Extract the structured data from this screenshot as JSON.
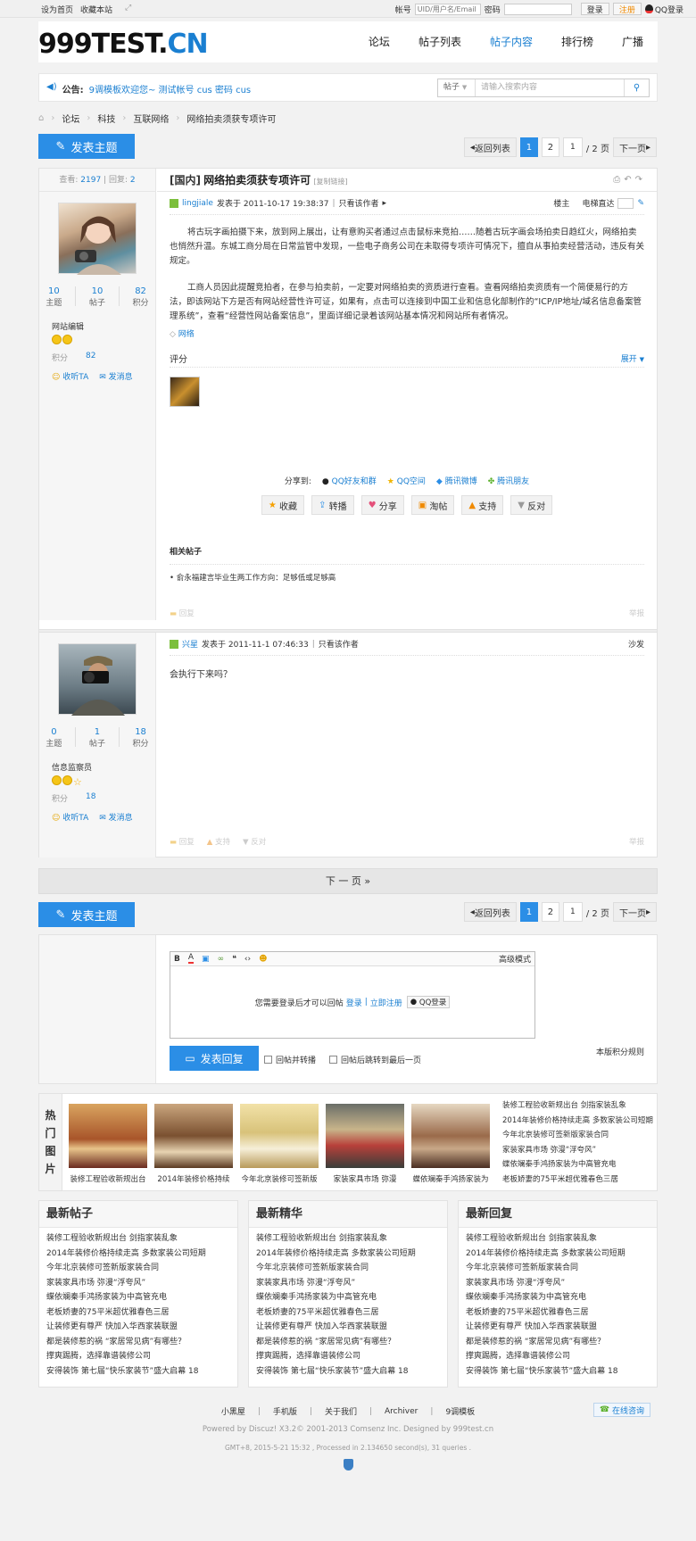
{
  "topbar": {
    "set_home": "设为首页",
    "bookmark": "收藏本站",
    "account_label": "帐号",
    "account_placeholder": "UID/用户名/Email",
    "password_label": "密码",
    "login": "登录",
    "register": "注册",
    "qq_login": "QQ登录"
  },
  "header": {
    "logo_main": "999TEST.",
    "logo_cn": "CN",
    "nav": [
      "论坛",
      "帖子列表",
      "帖子内容",
      "排行榜",
      "广播"
    ]
  },
  "notice": {
    "label": "公告:",
    "text": "9调模板欢迎您~ 测试帐号 cus 密码  cus",
    "search_type": "帖子",
    "search_placeholder": "请输入搜索内容"
  },
  "breadcrumb": [
    "论坛",
    "科技",
    "互联网络",
    "网络拍卖须获专项许可"
  ],
  "actions": {
    "post_new": "发表主题",
    "back_list": "返回列表",
    "page1": "1",
    "page2": "2",
    "page_input": "1",
    "page_total": "/ 2 页",
    "next_page": "下一页"
  },
  "thread": {
    "views_label": "查看:",
    "views": "2197",
    "replies_label": "回复:",
    "replies": "2",
    "prefix": "[国内]",
    "title": "网络拍卖须获专项许可",
    "copy_link": "[复制链接]"
  },
  "post1": {
    "author": "lingjiale",
    "posted": "发表于 2011-10-17 19:38:37",
    "only_author": "只看该作者",
    "floor": "楼主",
    "floor_jump": "电梯直达",
    "stats": [
      {
        "v": "10",
        "l": "主题"
      },
      {
        "v": "10",
        "l": "帖子"
      },
      {
        "v": "82",
        "l": "积分"
      }
    ],
    "group": "网站编辑",
    "points_label": "积分",
    "points": "82",
    "follow": "收听TA",
    "message": "发消息",
    "para1": "将古玩字画拍摄下来，放到网上展出，让有意购买者通过点击鼠标来竞拍……随着古玩字画会场拍卖日趋红火，网络拍卖也悄然升温。东城工商分局在日常监管中发现，一些电子商务公司在未取得专项许可情况下，擅自从事拍卖经营活动，违反有关规定。",
    "para2": "工商人员因此提醒竞拍者，在参与拍卖前，一定要对网络拍卖的资质进行查看。查看网络拍卖资质有一个简便易行的方法，即该网站下方是否有网站经营性许可证，如果有，点击可以连接到中国工业和信息化部制作的“ICP/IP地址/域名信息备案管理系统”，查看“经营性网站备案信息”，里面详细记录着该网站基本情况和网站所有者情况。",
    "tag": "网络",
    "rating": "评分",
    "expand": "展开",
    "share_label": "分享到:",
    "share": [
      "QQ好友和群",
      "QQ空间",
      "腾讯微博",
      "腾讯朋友"
    ],
    "buttons": [
      "收藏",
      "转播",
      "分享",
      "淘帖",
      "支持",
      "反对"
    ],
    "related_title": "相关帖子",
    "related_item": "• 俞永福建言毕业生两工作方向：足够低或足够高",
    "reply": "回复",
    "report": "举报"
  },
  "post2": {
    "author": "兴星",
    "posted": "发表于 2011-11-1 07:46:33",
    "only_author": "只看该作者",
    "floor": "沙发",
    "stats": [
      {
        "v": "0",
        "l": "主题"
      },
      {
        "v": "1",
        "l": "帖子"
      },
      {
        "v": "18",
        "l": "积分"
      }
    ],
    "group": "信息监察员",
    "points_label": "积分",
    "points": "18",
    "follow": "收听TA",
    "message": "发消息",
    "text": "会执行下来吗？",
    "reply": "回复",
    "support": "支持",
    "oppose": "反对",
    "report": "举报"
  },
  "next_bar": "下 一 页  »",
  "editor": {
    "advanced": "高级模式",
    "login_tip": "您需要登录后才可以回帖",
    "login": "登录",
    "sep": "|",
    "register": "立即注册",
    "qq_login": "QQ登录",
    "submit": "发表回复",
    "opt1": "回帖并转播",
    "opt2": "回帖后跳转到最后一页",
    "rules": "本版积分规则"
  },
  "gallery": {
    "label": [
      "热",
      "门",
      "图",
      "片"
    ],
    "captions": [
      "装修工程验收新规出台",
      "2014年装修价格持续",
      "今年北京装修可签新版",
      "家装家具市场 弥漫",
      "蝶依斓秦手鸿扬家装为"
    ],
    "list": [
      "装修工程验收新规出台 剑指家装乱象",
      "2014年装修价格持续走高 多数家装公司短期",
      "今年北京装修可签新版家装合同",
      "家装家具市场 弥漫“浮夸风”",
      "蝶依斓秦手鸿扬家装为中高管充电",
      "老板娇妻的75平米超优雅春色三居"
    ]
  },
  "lists": [
    {
      "title": "最新帖子",
      "items": [
        "装修工程验收新规出台 剑指家装乱象",
        "2014年装修价格持续走高 多数家装公司短期",
        "今年北京装修可签新版家装合同",
        "家装家具市场 弥漫“浮夸风”",
        "蝶依斓秦手鸿扬家装为中高管充电",
        "老板娇妻的75平米超优雅春色三居",
        "让装修更有尊严 快加入华西家装联盟",
        "都是装修惹的祸 “家居常见病”有哪些？",
        "撑爽踢腾，选择靠谱装修公司",
        "安得装饰 第七届“快乐家装节”盛大启幕 18"
      ]
    },
    {
      "title": "最新精华",
      "items": [
        "装修工程验收新规出台 剑指家装乱象",
        "2014年装修价格持续走高 多数家装公司短期",
        "今年北京装修可签新版家装合同",
        "家装家具市场 弥漫“浮夸风”",
        "蝶依斓秦手鸿扬家装为中高管充电",
        "老板娇妻的75平米超优雅春色三居",
        "让装修更有尊严 快加入华西家装联盟",
        "都是装修惹的祸 “家居常见病”有哪些？",
        "撑爽踢腾，选择靠谱装修公司",
        "安得装饰 第七届“快乐家装节”盛大启幕 18"
      ]
    },
    {
      "title": "最新回复",
      "items": [
        "装修工程验收新规出台 剑指家装乱象",
        "2014年装修价格持续走高 多数家装公司短期",
        "今年北京装修可签新版家装合同",
        "家装家具市场 弥漫“浮夸风”",
        "蝶依斓秦手鸿扬家装为中高管充电",
        "老板娇妻的75平米超优雅春色三居",
        "让装修更有尊严 快加入华西家装联盟",
        "都是装修惹的祸 “家居常见病”有哪些？",
        "撑爽踢腾，选择靠谱装修公司",
        "安得装饰 第七届“快乐家装节”盛大启幕 18"
      ]
    }
  ],
  "footer": {
    "links": [
      "小黑屋",
      "手机版",
      "关于我们",
      "Archiver",
      "9调模板"
    ],
    "online": "在线咨询",
    "powered": "Powered by Discuz! X3.2© 2001-2013 Comsenz Inc. Designed by 999test.cn",
    "gmt": "GMT+8, 2015-5-21 15:32 , Processed in 2.134650 second(s), 31 queries ."
  },
  "colors": {
    "accent": "#2b8ee6",
    "link": "#1a7fd1",
    "register": "#f08a00"
  }
}
